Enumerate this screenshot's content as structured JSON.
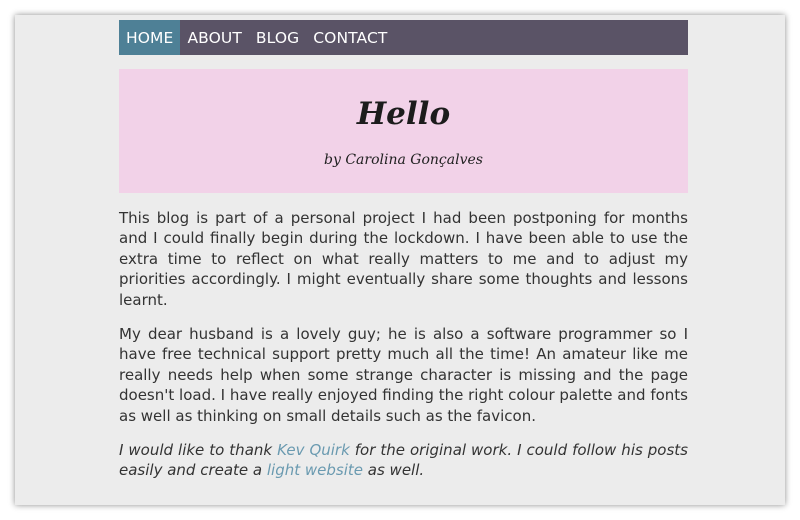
{
  "nav": {
    "items": [
      {
        "label": "HOME",
        "active": true
      },
      {
        "label": "ABOUT",
        "active": false
      },
      {
        "label": "BLOG",
        "active": false
      },
      {
        "label": "CONTACT",
        "active": false
      }
    ]
  },
  "banner": {
    "title": "Hello",
    "subtitle": "by Carolina Gonçalves"
  },
  "content": {
    "paragraph1": "This blog is part of a personal project I had been postponing for months and I could finally begin during the lockdown. I have been able to use the extra time to reflect on what really matters to me and to adjust my priorities accordingly. I might eventually share some thoughts and lessons learnt.",
    "paragraph2": "My dear husband is a lovely guy; he is also a software programmer so I have free technical support pretty much all the time! An amateur like me really needs help when some strange character is missing and the page doesn't load. I have really enjoyed finding the right colour palette and fonts as well as thinking on small details such as the favicon.",
    "thanks": {
      "part1": "I would like to thank ",
      "link1": "Kev Quirk",
      "part2": " for the original work. I could follow his posts easily and create a ",
      "link2": "light website",
      "part3": " as well."
    }
  },
  "colors": {
    "nav_background": "#5a5366",
    "nav_active": "#4e8096",
    "banner_background": "#f2d2e8",
    "page_background": "#ececec",
    "link": "#6a9ab0"
  }
}
